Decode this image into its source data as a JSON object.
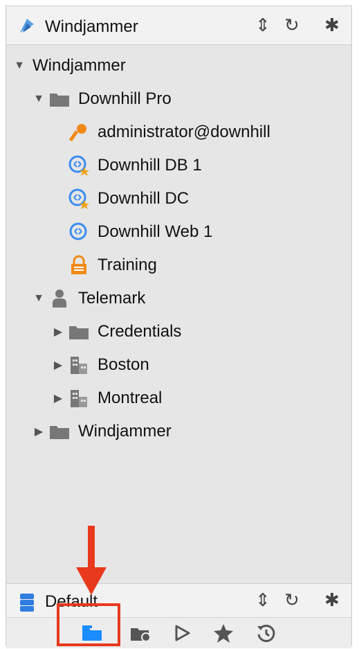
{
  "header": {
    "title": "Windjammer",
    "icons": [
      "windjammer-logo-icon",
      "sort-icon",
      "refresh-icon",
      "gear-icon"
    ],
    "sort_glyph": "⇕",
    "refresh_glyph": "↻",
    "gear_glyph": "✱"
  },
  "tree": [
    {
      "label": "Windjammer",
      "icon": "none",
      "state": "expanded",
      "depth": 0
    },
    {
      "label": "Downhill Pro",
      "icon": "folder-icon",
      "state": "expanded",
      "depth": 1
    },
    {
      "label": "administrator@downhill",
      "icon": "key-icon",
      "state": "leaf",
      "depth": 2
    },
    {
      "label": "Downhill DB 1",
      "icon": "remote-desktop-favorite-icon",
      "state": "leaf",
      "depth": 2
    },
    {
      "label": "Downhill DC",
      "icon": "remote-desktop-favorite-icon",
      "state": "leaf",
      "depth": 2
    },
    {
      "label": "Downhill Web 1",
      "icon": "remote-desktop-icon",
      "state": "leaf",
      "depth": 2
    },
    {
      "label": "Training",
      "icon": "lock-icon",
      "state": "leaf",
      "depth": 2
    },
    {
      "label": "Telemark",
      "icon": "person-icon",
      "state": "expanded",
      "depth": 1
    },
    {
      "label": "Credentials",
      "icon": "folder-icon",
      "state": "collapsed",
      "depth": 2
    },
    {
      "label": "Boston",
      "icon": "building-icon",
      "state": "collapsed",
      "depth": 2
    },
    {
      "label": "Montreal",
      "icon": "building-icon",
      "state": "collapsed",
      "depth": 2
    },
    {
      "label": "Windjammer",
      "icon": "folder-icon",
      "state": "collapsed",
      "depth": 1
    }
  ],
  "footer": {
    "title": "Default",
    "icons": [
      "database-icon",
      "sort-icon",
      "refresh-icon",
      "gear-icon"
    ]
  },
  "toolbar": {
    "buttons": [
      "folder-tab-icon",
      "vault-icon",
      "play-icon",
      "star-icon",
      "history-icon"
    ],
    "active_color": "#1a8cff",
    "inactive_color": "#555555"
  },
  "annotation": {
    "color": "#e8391d"
  },
  "colors": {
    "accent_blue": "#3b8cf0",
    "orange": "#f08a17",
    "folder_gray": "#777777"
  }
}
